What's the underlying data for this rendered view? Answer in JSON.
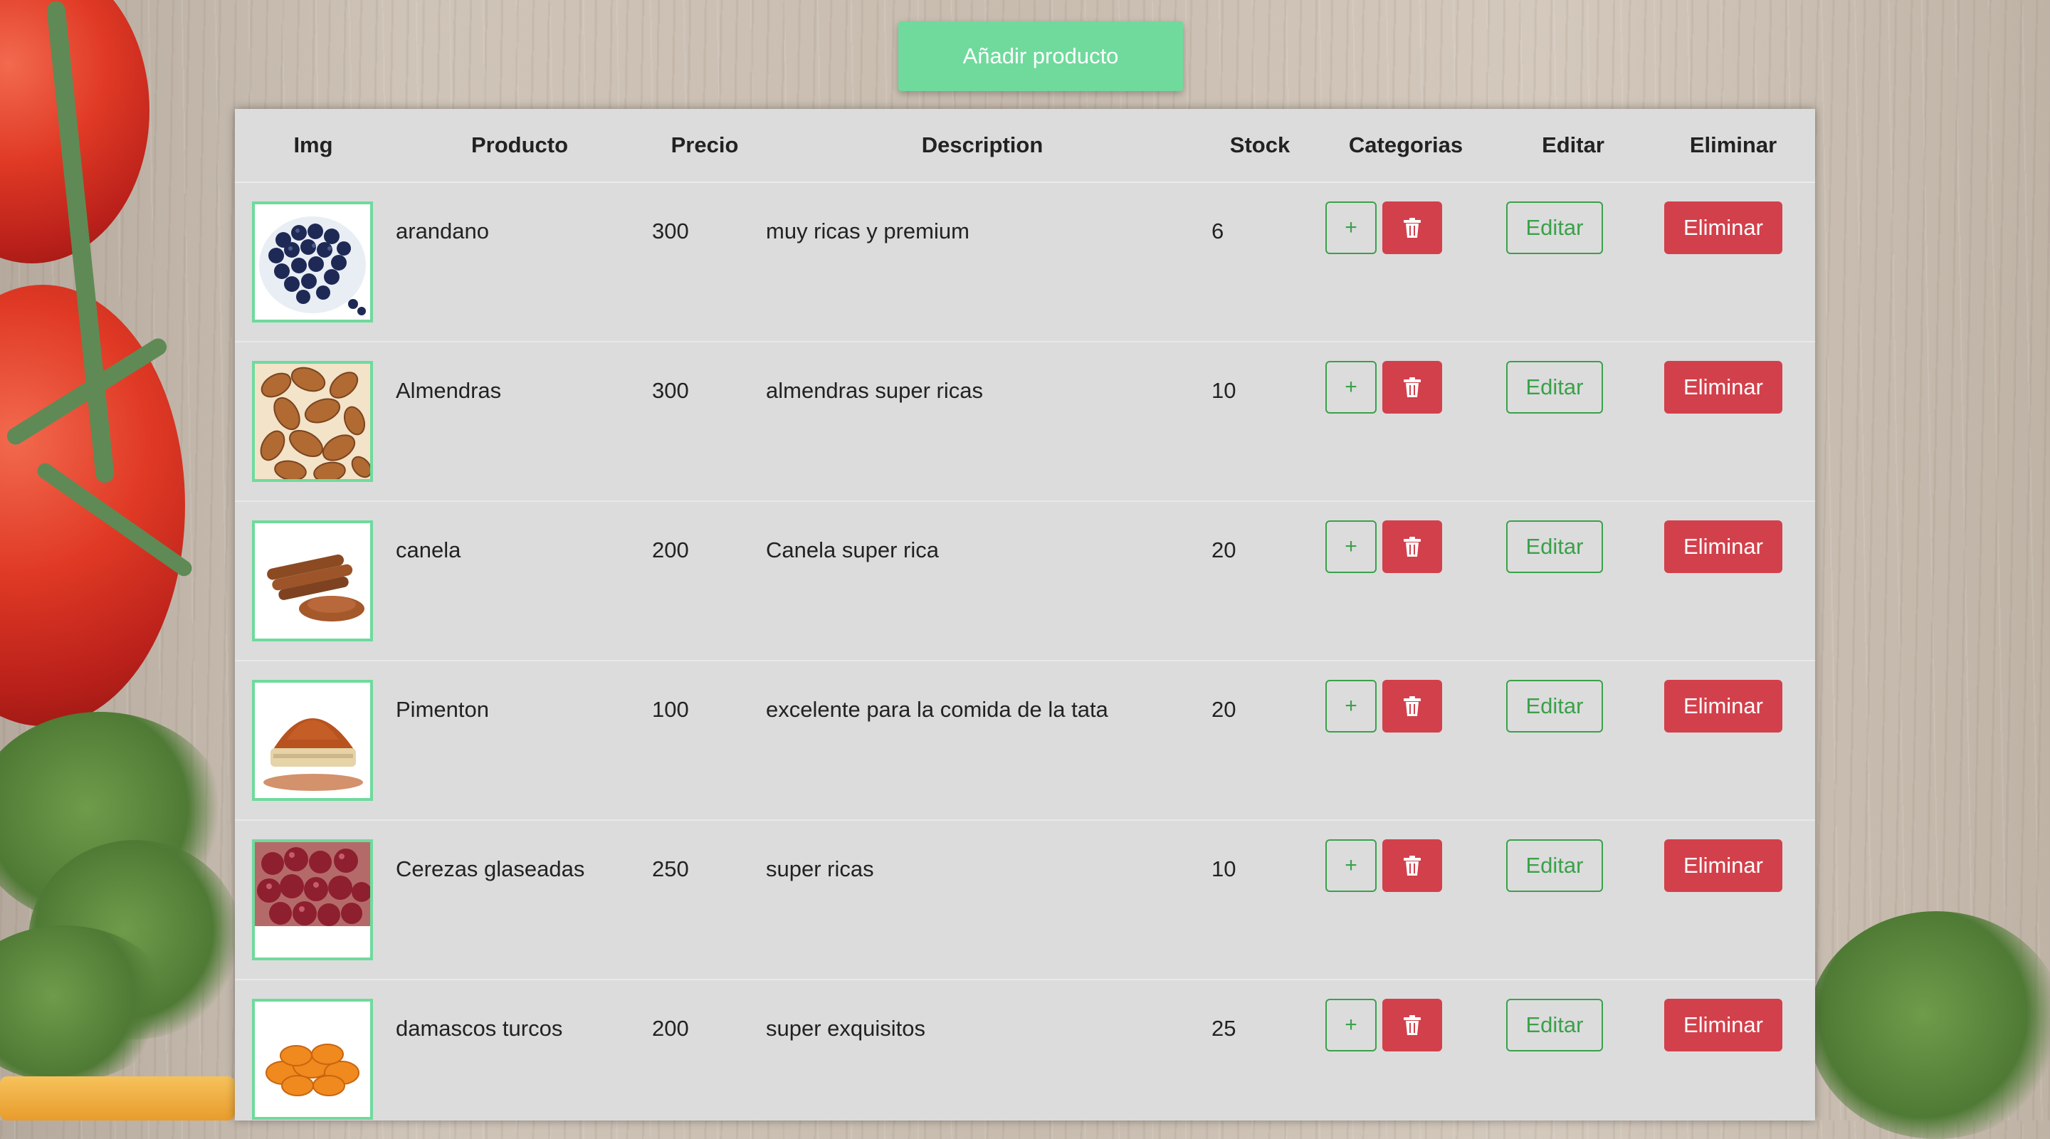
{
  "header": {
    "add_label": "Añadir producto"
  },
  "table": {
    "columns": [
      "Img",
      "Producto",
      "Precio",
      "Description",
      "Stock",
      "Categorias",
      "Editar",
      "Eliminar"
    ],
    "rows": [
      {
        "img": "blueberries",
        "product": "arandano",
        "price": "300",
        "description": "muy ricas y premium",
        "stock": "6"
      },
      {
        "img": "almonds",
        "product": "Almendras",
        "price": "300",
        "description": "almendras super ricas",
        "stock": "10"
      },
      {
        "img": "cinnamon",
        "product": "canela",
        "price": "200",
        "description": "Canela super rica",
        "stock": "20"
      },
      {
        "img": "paprika",
        "product": "Pimenton",
        "price": "100",
        "description": "excelente para la comida de la tata",
        "stock": "20"
      },
      {
        "img": "glazed-cherries",
        "product": "Cerezas glaseadas",
        "price": "250",
        "description": "super ricas",
        "stock": "10"
      },
      {
        "img": "dried-apricots",
        "product": "damascos turcos",
        "price": "200",
        "description": "super exquisitos",
        "stock": "25"
      }
    ]
  },
  "actions": {
    "plus_label": "+",
    "edit_label": "Editar",
    "delete_label": "Eliminar",
    "trash_icon": "trash-icon"
  },
  "colors": {
    "accent_green": "#6fda9c",
    "outline_green": "#3aa14a",
    "danger_red": "#d2404b",
    "panel_gray": "#dcdcdc"
  }
}
